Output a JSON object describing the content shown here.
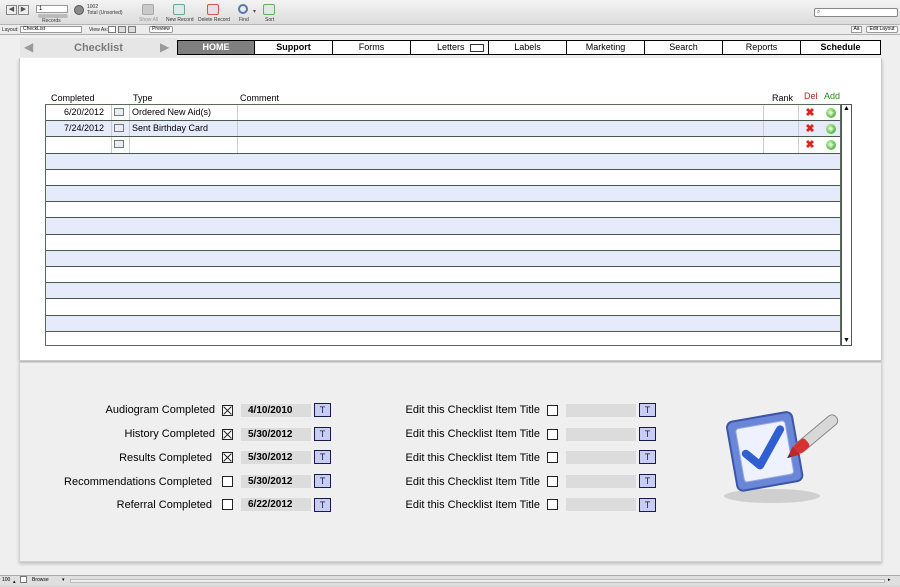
{
  "toolbar": {
    "record_number": "1",
    "records_label": "Records",
    "total_count": "1002",
    "total_label": "Total (Unsorted)",
    "buttons": [
      "Show All",
      "New Record",
      "Delete Record",
      "Find",
      "Sort"
    ],
    "search_placeholder": ""
  },
  "layout_bar": {
    "layout_label": "Layout:",
    "layout_value": "CheckList",
    "view_as_label": "View As:",
    "preview_label": "Preview",
    "aa_label": "Aä",
    "edit_layout_label": "Edit Layout"
  },
  "nav": {
    "title": "Checklist",
    "tabs": [
      "HOME",
      "Support",
      "Forms",
      "Letters",
      "Labels",
      "Marketing",
      "Search",
      "Reports",
      "Schedule"
    ]
  },
  "checklist_table": {
    "headers": {
      "completed": "Completed",
      "type": "Type",
      "comment": "Comment",
      "rank": "Rank",
      "del": "Del",
      "add": "Add"
    },
    "rows": [
      {
        "completed": "6/20/2012",
        "type": "Ordered New Aid(s)",
        "comment": "",
        "rank": ""
      },
      {
        "completed": "7/24/2012",
        "type": "Sent Birthday Card",
        "comment": "",
        "rank": ""
      },
      {
        "completed": "",
        "type": "",
        "comment": "",
        "rank": ""
      }
    ]
  },
  "checklist_items": {
    "left": [
      {
        "label": "Audiogram Completed",
        "checked": true,
        "date": "4/10/2010",
        "button": "T"
      },
      {
        "label": "History Completed",
        "checked": true,
        "date": "5/30/2012",
        "button": "T"
      },
      {
        "label": "Results Completed",
        "checked": true,
        "date": "5/30/2012",
        "button": "T"
      },
      {
        "label": "Recommendations Completed",
        "checked": false,
        "date": "5/30/2012",
        "button": "T"
      },
      {
        "label": "Referral Completed",
        "checked": false,
        "date": "6/22/2012",
        "button": "T"
      }
    ],
    "right": [
      {
        "label": "Edit this Checklist Item Title",
        "checked": false,
        "date": "",
        "button": "T"
      },
      {
        "label": "Edit this Checklist Item Title",
        "checked": false,
        "date": "",
        "button": "T"
      },
      {
        "label": "Edit this Checklist Item Title",
        "checked": false,
        "date": "",
        "button": "T"
      },
      {
        "label": "Edit this Checklist Item Title",
        "checked": false,
        "date": "",
        "button": "T"
      },
      {
        "label": "Edit this Checklist Item Title",
        "checked": false,
        "date": "",
        "button": "T"
      }
    ]
  },
  "status_bar": {
    "zoom": "100",
    "mode": "Browse"
  },
  "colors": {
    "accent_tab": "#808080",
    "row_alt": "#e6ebfb",
    "delete": "#e0211d",
    "add": "#3aa52a",
    "t_button": "#c8cdf5"
  }
}
